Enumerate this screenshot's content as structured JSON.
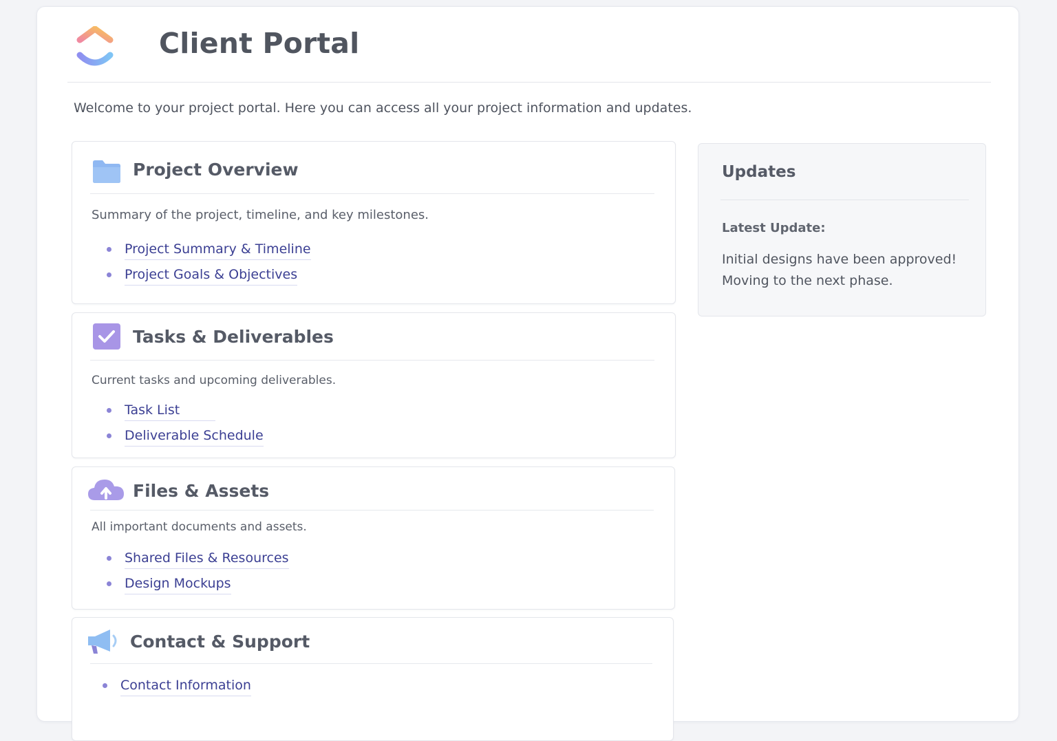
{
  "header": {
    "title": "Client Portal",
    "logo_icon": "colorful-chevron-logo"
  },
  "welcome_text": "Welcome to your project portal. Here you can access all your project information and updates.",
  "sections": [
    {
      "title": "Project Overview",
      "icon": "folder-icon",
      "description": "Summary of the project, timeline, and key milestones.",
      "links": [
        "Project Summary & Timeline",
        "Project Goals & Objectives"
      ]
    },
    {
      "title": "Tasks & Deliverables",
      "icon": "checkbox-icon",
      "description": "Current tasks and upcoming deliverables.",
      "links": [
        "Task List",
        "Deliverable Schedule"
      ]
    },
    {
      "title": "Files & Assets",
      "icon": "cloud-upload-icon",
      "description": "All important documents and assets.",
      "links": [
        "Shared Files & Resources",
        "Design Mockups"
      ]
    },
    {
      "title": "Contact & Support",
      "icon": "megaphone-icon",
      "description": "",
      "links": [
        "Contact Information"
      ]
    }
  ],
  "updates": {
    "title": "Updates",
    "latest_label": "Latest Update:",
    "latest_text": "Initial designs have been approved! Moving to the next phase."
  },
  "colors": {
    "link": "#3b3f93",
    "bullet": "#8b84d6",
    "folder": "#8fb8f2",
    "check": "#a895e6",
    "cloud": "#a99be8",
    "megaphone": "#8fbdf2"
  }
}
